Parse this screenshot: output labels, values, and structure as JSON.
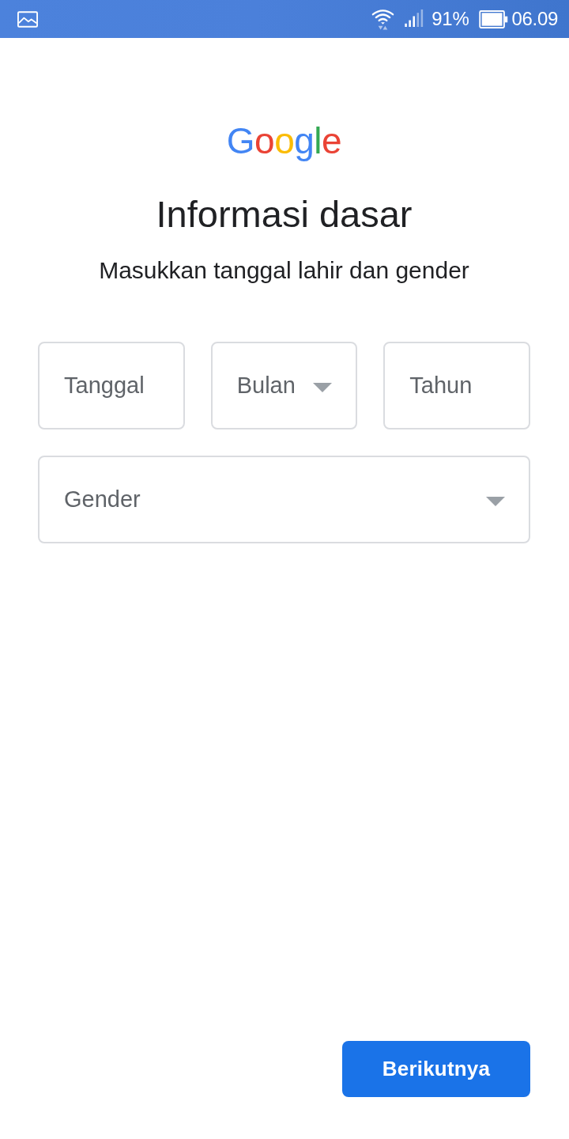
{
  "status_bar": {
    "battery": "91%",
    "time": "06.09"
  },
  "logo": "Google",
  "title": "Informasi dasar",
  "subtitle": "Masukkan tanggal lahir dan gender",
  "birth_date_fields": [
    {
      "kind": "text",
      "placeholder": "Tanggal"
    },
    {
      "kind": "dropdown",
      "placeholder": "Bulan"
    },
    {
      "kind": "text",
      "placeholder": "Tahun"
    }
  ],
  "gender_field": {
    "kind": "dropdown",
    "placeholder": "Gender"
  },
  "buttons": [
    {
      "label": "Berikutnya"
    }
  ]
}
